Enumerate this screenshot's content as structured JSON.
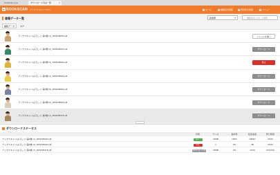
{
  "browser": {
    "tabs": [
      {
        "label": "bookscan.co.jp"
      },
      {
        "label": "ダウンロード済み一覧"
      }
    ]
  },
  "header": {
    "logo_text": "BOOKSCAN",
    "app_name": "ブックスキャン Web",
    "nav": [
      {
        "label": "ホーム"
      },
      {
        "label": "書籍名を検索"
      },
      {
        "label": "著者名を検索"
      },
      {
        "label": "メニュー"
      }
    ]
  },
  "toolbar": {
    "title": "書籍データ一覧",
    "sort_value": "新着順",
    "search_placeholder": "書籍名を入力して検索"
  },
  "subtabs": [
    {
      "label": "書籍データ",
      "active": true
    },
    {
      "label": "タグ",
      "active": false
    }
  ],
  "books": [
    {
      "filename": "ブックスキャン(よろしく) 第1巻 (1)_4061038240.pdf",
      "action": "ファイルを開く",
      "style": "open",
      "shirt": "#c9a46b"
    },
    {
      "filename": "ブックスキャン(よろしく) 第1巻 (2)_4061038243.pdf",
      "action": "ダウンロード",
      "style": "gray",
      "shirt": "#2f8f6a"
    },
    {
      "filename": "ブックスキャン(よろしく) 第1巻 (3)_4061038240.pdf",
      "action": "停止",
      "style": "red",
      "shirt": "#e0b23a"
    },
    {
      "filename": "ブックスキャン(よろしく) 第1巻 (4)_4061038023.pdf",
      "action": "ダウンロード",
      "style": "gray",
      "shirt": "#f0c847"
    },
    {
      "filename": "ブックスキャン(よろしく) 第1巻 (5)_4061038004.pdf",
      "action": "ダウンロード",
      "style": "gray",
      "shirt": "#7a86a8"
    },
    {
      "filename": "ブックスキャン(よろしく) 第1巻 (6)_4061038023.pdf",
      "action": "ダウンロード",
      "style": "gray",
      "shirt": "#d8d0b8"
    },
    {
      "filename": "ブックスキャン(よろしく) 第1巻 (7)_4061038178.pdf",
      "action": "ダウンロード",
      "style": "gray",
      "shirt": "#a7865a",
      "highlight": true
    }
  ],
  "downloads": {
    "title": "ダウンロードステータス",
    "columns": {
      "status": "状態",
      "size": "サイズ",
      "progress": "進捗率",
      "speed": "転送速度",
      "remaining": "残り時間"
    },
    "rows": [
      {
        "name": "ブックスキャン(よろしく) 第1巻 (1)_4061038240.pdf",
        "status": "完了",
        "status_style": "green",
        "size": "20MB",
        "progress": "100%",
        "speed": "10KB/s",
        "remaining": "00:00"
      },
      {
        "name": "ブックスキャン(よろしく) 第1巻 (3)_4061038240.pdf",
        "status": "停止",
        "status_style": "red",
        "size": "1",
        "progress": "0%",
        "speed": "0B",
        "remaining": "00:00"
      },
      {
        "name": "ブックスキャン(よろしく) 第1巻 (7)_4061038178.pdf",
        "status": "ダウンロード中",
        "status_style": "gray",
        "size": "20MB",
        "progress": "4%",
        "speed": "10:00",
        "remaining": "00:04:00"
      }
    ]
  }
}
